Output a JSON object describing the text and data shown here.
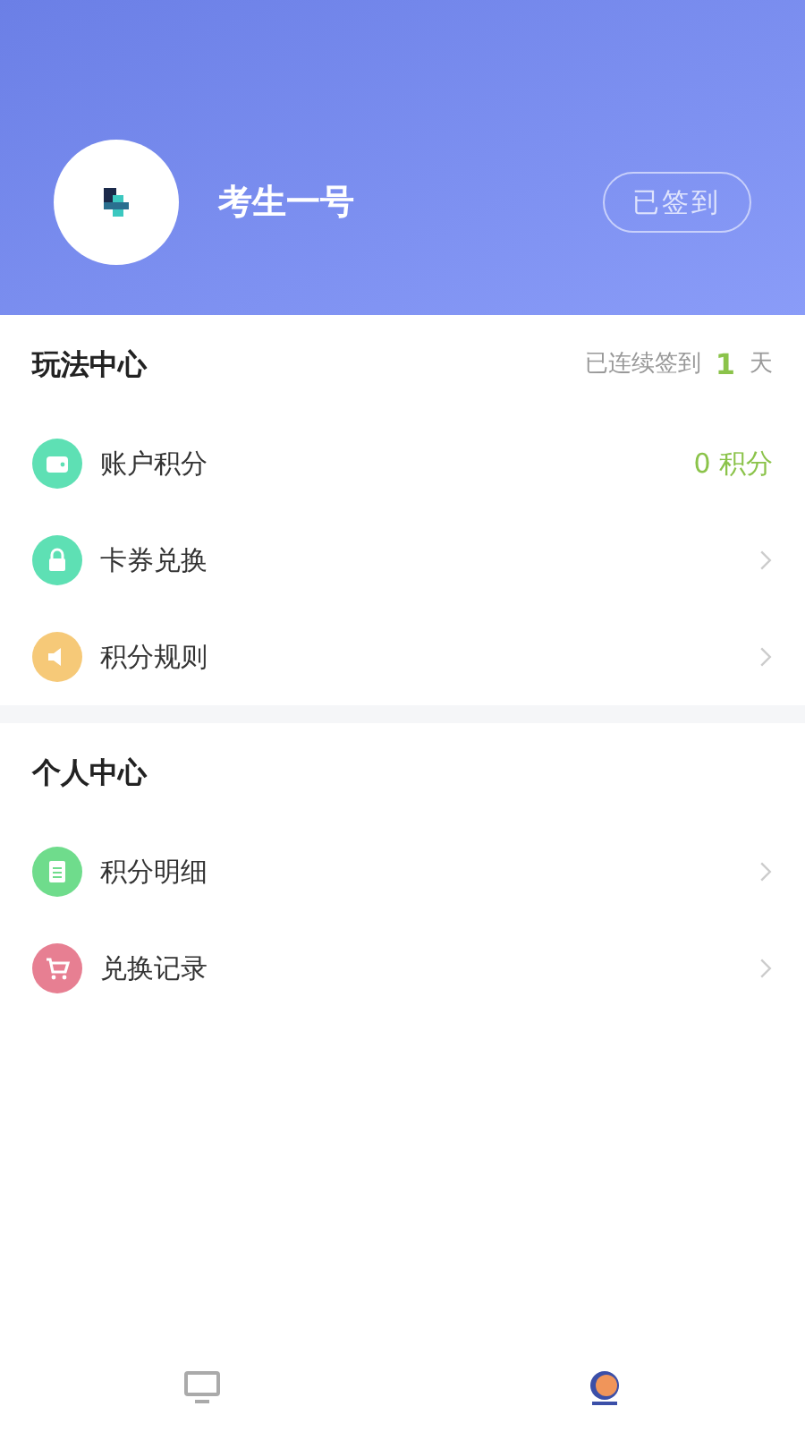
{
  "profile": {
    "name": "考生一号",
    "sign_button": "已签到"
  },
  "sections": [
    {
      "title": "玩法中心",
      "streak": {
        "prefix": "已连续签到",
        "count": "1",
        "suffix": "天"
      },
      "items": [
        {
          "label": "账户积分",
          "kind": "value",
          "value": "0 积分",
          "color": "#5ee0b4"
        },
        {
          "label": "卡券兑换",
          "kind": "link",
          "color": "#5ee0b4"
        },
        {
          "label": "积分规则",
          "kind": "link",
          "color": "#f6c978"
        }
      ]
    },
    {
      "title": "个人中心",
      "items": [
        {
          "label": "积分明细",
          "kind": "link",
          "color": "#6fdc8c"
        },
        {
          "label": "兑换记录",
          "kind": "link",
          "color": "#e77f92"
        }
      ]
    }
  ],
  "tabs": [
    {
      "selected": false
    },
    {
      "selected": true
    }
  ]
}
